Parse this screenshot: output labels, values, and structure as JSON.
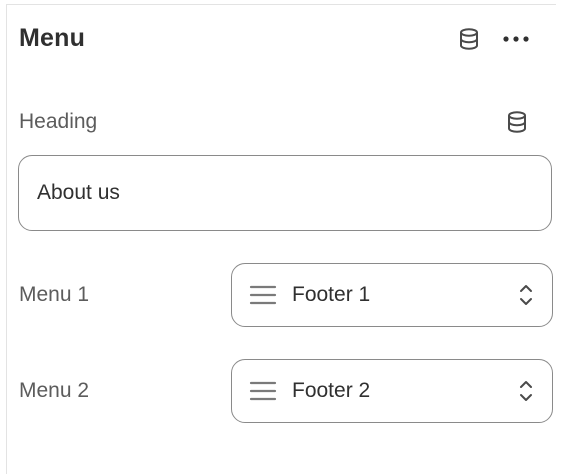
{
  "header": {
    "title": "Menu",
    "data_source_icon": "database-icon",
    "more_icon": "more-horizontal-icon"
  },
  "heading": {
    "label": "Heading",
    "data_source_icon": "database-icon",
    "value": "About us"
  },
  "menus": [
    {
      "label": "Menu 1",
      "icon": "menu-lines-icon",
      "value": "Footer 1",
      "chevron_icon": "chevron-up-down-icon"
    },
    {
      "label": "Menu 2",
      "icon": "menu-lines-icon",
      "value": "Footer 2",
      "chevron_icon": "chevron-up-down-icon"
    }
  ],
  "colors": {
    "text": "#303030",
    "label": "#5c5c5c",
    "border": "#8a8a8a",
    "icon": "#4a4a4a"
  }
}
